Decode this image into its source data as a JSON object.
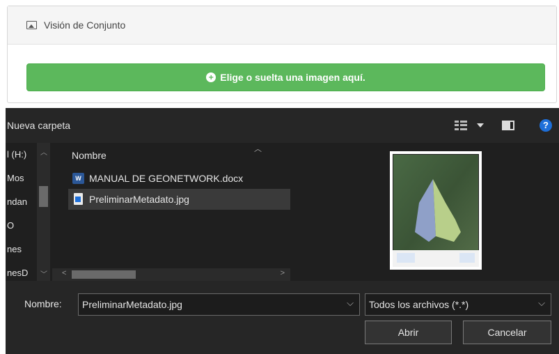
{
  "panel": {
    "title": "Visión de Conjunto",
    "drop_label": "Elige o suelta una imagen aquí."
  },
  "dialog": {
    "toolbar": {
      "new_folder": "Nueva carpeta",
      "help": "?"
    },
    "nav_items": [
      "l (H:)",
      "Mos",
      "ndan",
      "O",
      "nes",
      "nesD"
    ],
    "column_header": "Nombre",
    "files": [
      {
        "name": "MANUAL DE GEONETWORK.docx",
        "type": "word",
        "selected": false
      },
      {
        "name": "PreliminarMetadato.jpg",
        "type": "jpg",
        "selected": true
      }
    ],
    "filename_label": "Nombre:",
    "filename_value": "PreliminarMetadato.jpg",
    "filter_value": "Todos los archivos (*.*)",
    "open_button": "Abrir",
    "cancel_button": "Cancelar"
  },
  "colors": {
    "accent_green": "#5cb85c",
    "dialog_bg": "#1f1f1f",
    "help_blue": "#1e6fd9"
  }
}
